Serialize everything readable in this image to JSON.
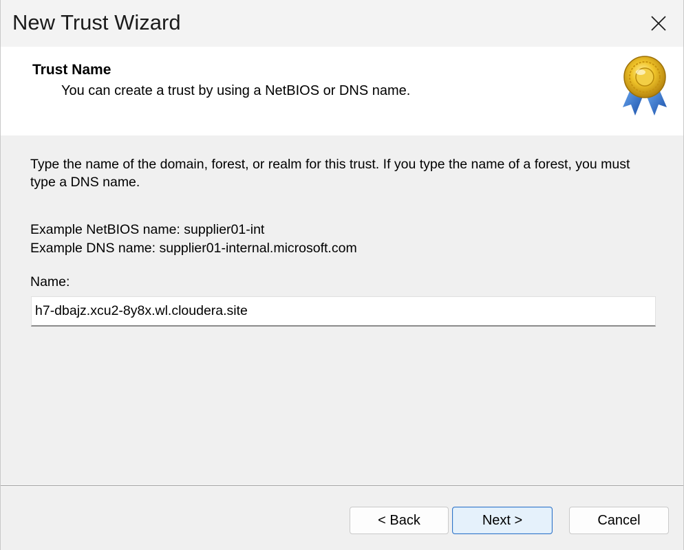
{
  "window": {
    "title": "New Trust Wizard"
  },
  "header": {
    "title": "Trust Name",
    "subtitle": "You can create a trust by using a NetBIOS or DNS name.",
    "icon": "award-ribbon-icon"
  },
  "body": {
    "description": "Type the name of the domain, forest, or realm for this trust. If you type the name of a forest, you must type a DNS name.",
    "example_netbios": "Example NetBIOS name: supplier01-int",
    "example_dns": "Example DNS name: supplier01-internal.microsoft.com",
    "name_label": "Name:",
    "name_value": "h7-dbajz.xcu2-8y8x.wl.cloudera.site"
  },
  "buttons": {
    "back": "< Back",
    "next": "Next >",
    "cancel": "Cancel"
  },
  "colors": {
    "accent": "#2f73c8",
    "header_bg": "#ffffff",
    "body_bg": "#f0f0f0",
    "ribbon_gold": "#e2b219",
    "ribbon_blue": "#2a6fd1"
  }
}
